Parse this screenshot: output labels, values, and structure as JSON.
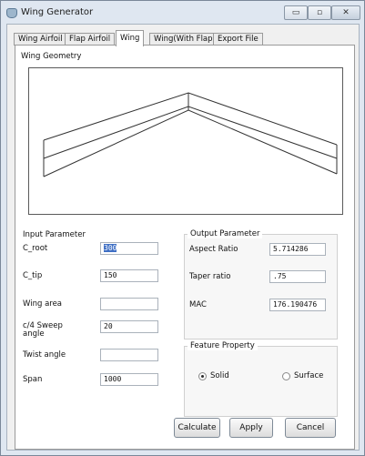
{
  "window": {
    "title": "Wing Generator",
    "controls": {
      "minimize": "▭",
      "maximize": "▫",
      "close": "✕"
    }
  },
  "tabs": [
    {
      "label": "Wing Airfoil",
      "active": false
    },
    {
      "label": "Flap Airfoil",
      "active": false
    },
    {
      "label": "Wing",
      "active": true
    },
    {
      "label": "Wing(With Flap)",
      "active": false
    },
    {
      "label": "Export File",
      "active": false
    }
  ],
  "geometry": {
    "title": "Wing Geometry"
  },
  "input": {
    "title": "Input Parameter",
    "fields": [
      {
        "label": "C_root",
        "value": "300",
        "selected": true
      },
      {
        "label": "C_tip",
        "value": "150"
      },
      {
        "label": "Wing area",
        "value": ""
      },
      {
        "label": "c/4 Sweep angle",
        "value": "20"
      },
      {
        "label": "Twist angle",
        "value": ""
      },
      {
        "label": "Span",
        "value": "1000"
      }
    ]
  },
  "output": {
    "title": "Output Parameter",
    "fields": [
      {
        "label": "Aspect Ratio",
        "value": "5.714286"
      },
      {
        "label": "Taper ratio",
        "value": ".75"
      },
      {
        "label": "MAC",
        "value": "176.190476"
      }
    ]
  },
  "feature": {
    "title": "Feature Property",
    "options": [
      {
        "label": "Solid",
        "checked": true
      },
      {
        "label": "Surface",
        "checked": false
      }
    ]
  },
  "buttons": {
    "calculate": "Calculate",
    "apply": "Apply",
    "cancel": "Cancel"
  },
  "colors": {
    "window_frame": "#dfe7f1",
    "panel": "#ffffff",
    "selection": "#3f6fc4"
  }
}
